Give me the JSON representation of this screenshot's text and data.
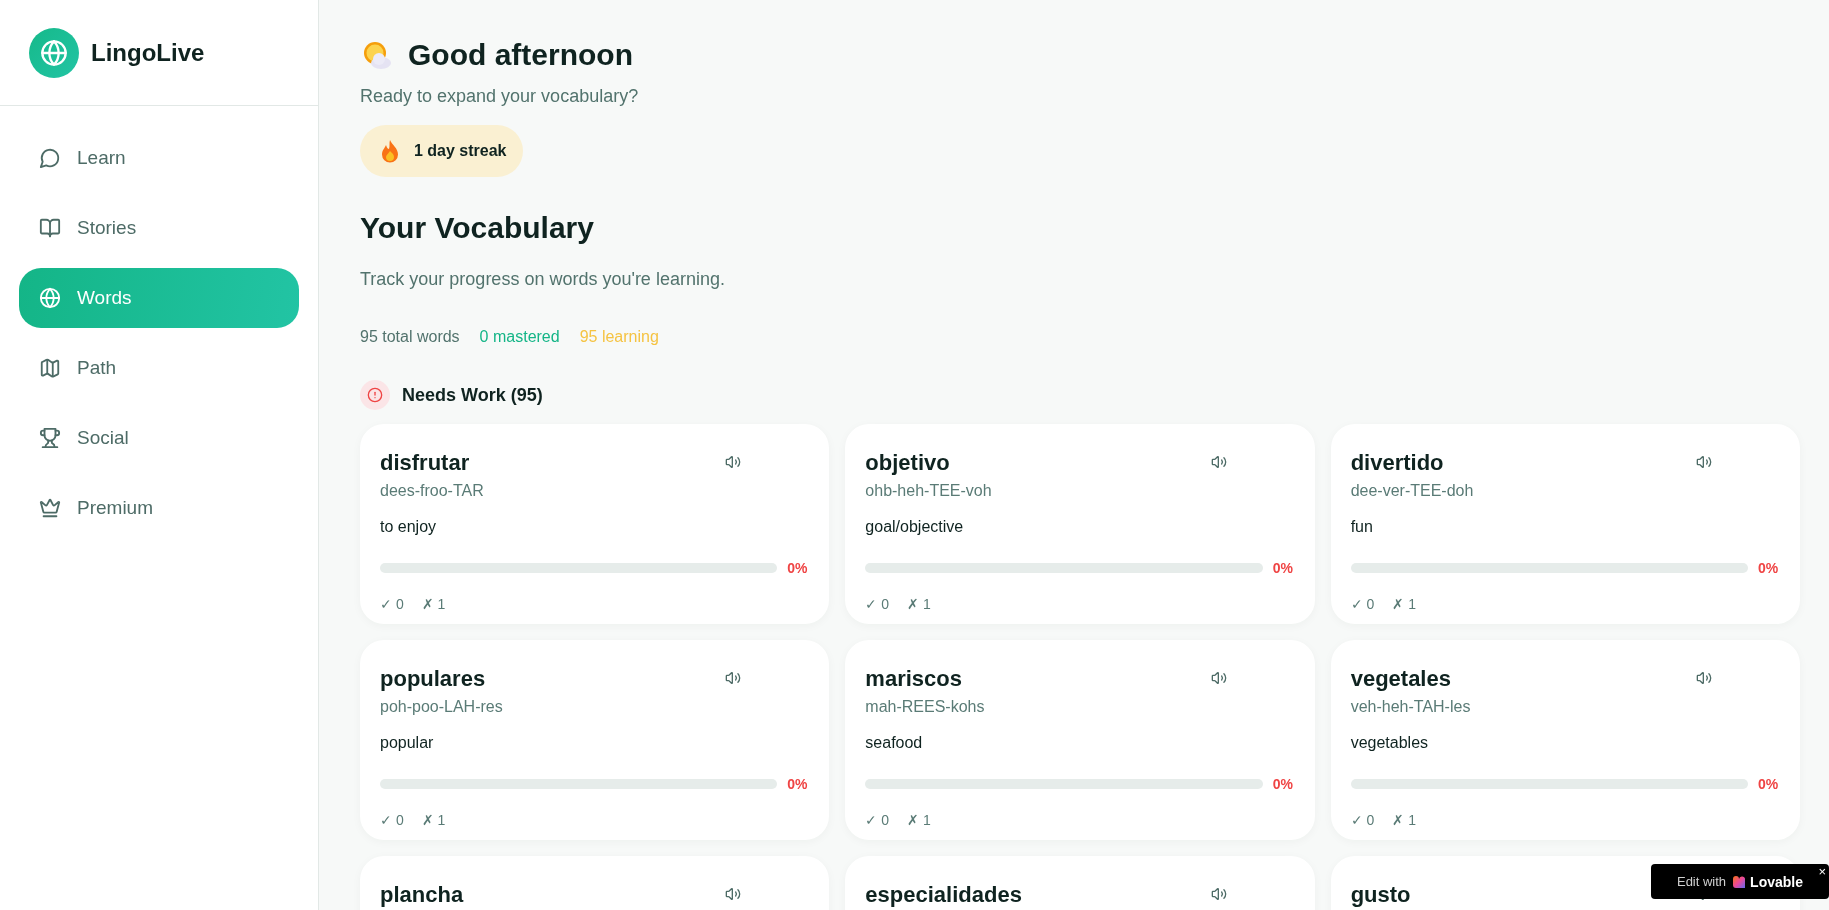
{
  "app": {
    "name": "LingoLive"
  },
  "sidebar": {
    "items": [
      {
        "label": "Learn",
        "selected": false
      },
      {
        "label": "Stories",
        "selected": false
      },
      {
        "label": "Words",
        "selected": true
      },
      {
        "label": "Path",
        "selected": false
      },
      {
        "label": "Social",
        "selected": false
      },
      {
        "label": "Premium",
        "selected": false
      }
    ]
  },
  "greeting": {
    "title": "Good afternoon",
    "subtitle": "Ready to expand your vocabulary?",
    "streak": "1 day streak"
  },
  "vocabulary": {
    "title": "Your Vocabulary",
    "subtitle": "Track your progress on words you're learning.",
    "stats": [
      {
        "kind": "total",
        "text": "95 total words"
      },
      {
        "kind": "mastered",
        "text": "0 mastered"
      },
      {
        "kind": "learning",
        "text": "95 learning"
      }
    ],
    "section": "Needs Work (95)",
    "cards": [
      {
        "word": "disfrutar",
        "pronunciation": "dees-froo-TAR",
        "meaning": "to enjoy",
        "level": 0,
        "percent": "0%",
        "correct": "✓ 0",
        "wrong": "✗ 1"
      },
      {
        "word": "objetivo",
        "pronunciation": "ohb-heh-TEE-voh",
        "meaning": "goal/objective",
        "level": 0,
        "percent": "0%",
        "correct": "✓ 0",
        "wrong": "✗ 1"
      },
      {
        "word": "divertido",
        "pronunciation": "dee-ver-TEE-doh",
        "meaning": "fun",
        "level": 0,
        "percent": "0%",
        "correct": "✓ 0",
        "wrong": "✗ 1"
      },
      {
        "word": "populares",
        "pronunciation": "poh-poo-LAH-res",
        "meaning": "popular",
        "level": 0,
        "percent": "0%",
        "correct": "✓ 0",
        "wrong": "✗ 1"
      },
      {
        "word": "mariscos",
        "pronunciation": "mah-REES-kohs",
        "meaning": "seafood",
        "level": 0,
        "percent": "0%",
        "correct": "✓ 0",
        "wrong": "✗ 1"
      },
      {
        "word": "vegetales",
        "pronunciation": "veh-heh-TAH-les",
        "meaning": "vegetables",
        "level": 0,
        "percent": "0%",
        "correct": "✓ 0",
        "wrong": "✗ 1"
      },
      {
        "word": "plancha"
      },
      {
        "word": "especialidades"
      },
      {
        "word": "gusto"
      }
    ]
  },
  "badge": {
    "prefix": "Edit with",
    "brand": "Lovable",
    "close": "×"
  }
}
